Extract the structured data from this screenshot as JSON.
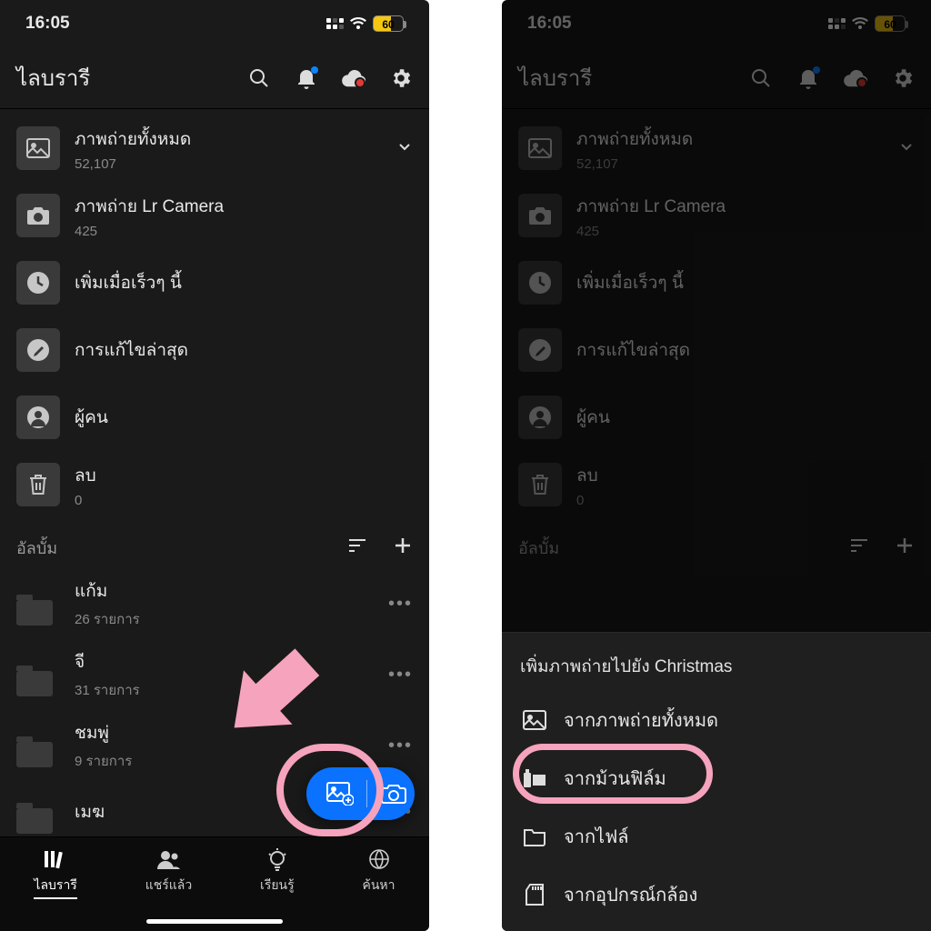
{
  "status": {
    "time": "16:05",
    "battery": "60"
  },
  "left": {
    "header": {
      "title": "ไลบรารี"
    },
    "rows": {
      "all": {
        "title": "ภาพถ่ายทั้งหมด",
        "subtitle": "52,107"
      },
      "lrcam": {
        "title": "ภาพถ่าย Lr Camera",
        "subtitle": "425"
      },
      "recent": {
        "title": "เพิ่มเมื่อเร็วๆ นี้"
      },
      "edits": {
        "title": "การแก้ไขล่าสุด"
      },
      "people": {
        "title": "ผู้คน"
      },
      "trash": {
        "title": "ลบ",
        "subtitle": "0"
      }
    },
    "section": {
      "title": "อัลบั้ม"
    },
    "albums": [
      {
        "title": "แก้ม",
        "subtitle": "26 รายการ"
      },
      {
        "title": "จี",
        "subtitle": "31 รายการ"
      },
      {
        "title": "ชมพู่",
        "subtitle": "9 รายการ"
      },
      {
        "title": "เมฆ"
      }
    ],
    "tabs": {
      "library": "ไลบรารี",
      "shared": "แชร์แล้ว",
      "learn": "เรียนรู้",
      "search": "ค้นหา"
    }
  },
  "right": {
    "header": {
      "title": "ไลบรารี"
    },
    "rows": {
      "all": {
        "title": "ภาพถ่ายทั้งหมด",
        "subtitle": "52,107"
      },
      "lrcam": {
        "title": "ภาพถ่าย Lr Camera",
        "subtitle": "425"
      },
      "recent": {
        "title": "เพิ่มเมื่อเร็วๆ นี้"
      },
      "edits": {
        "title": "การแก้ไขล่าสุด"
      },
      "people": {
        "title": "ผู้คน"
      },
      "trash": {
        "title": "ลบ",
        "subtitle": "0"
      }
    },
    "section": {
      "title": "อัลบั้ม"
    },
    "sheet": {
      "title": "เพิ่มภาพถ่ายไปยัง Christmas",
      "items": {
        "all": "จากภาพถ่ายทั้งหมด",
        "roll": "จากม้วนฟิล์ม",
        "files": "จากไฟล์",
        "camera": "จากอุปกรณ์กล้อง"
      }
    }
  }
}
